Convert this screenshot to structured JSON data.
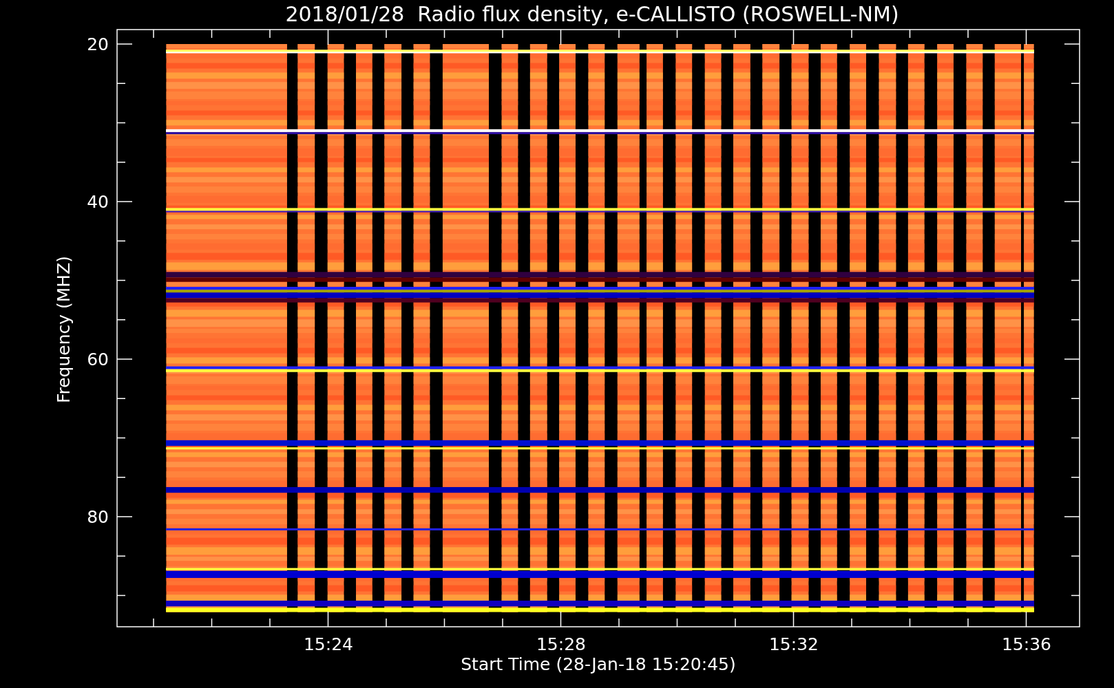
{
  "title": "2018/01/28  Radio flux density, e-CALLISTO (ROSWELL-NM)",
  "y_axis": {
    "label": "Frequency (MHZ)",
    "ticks": [
      "20",
      "40",
      "60",
      "80"
    ]
  },
  "x_axis": {
    "label": "Start Time (28-Jan-18 15:20:45)",
    "ticks": [
      "15:24",
      "15:28",
      "15:32",
      "15:36"
    ]
  }
}
